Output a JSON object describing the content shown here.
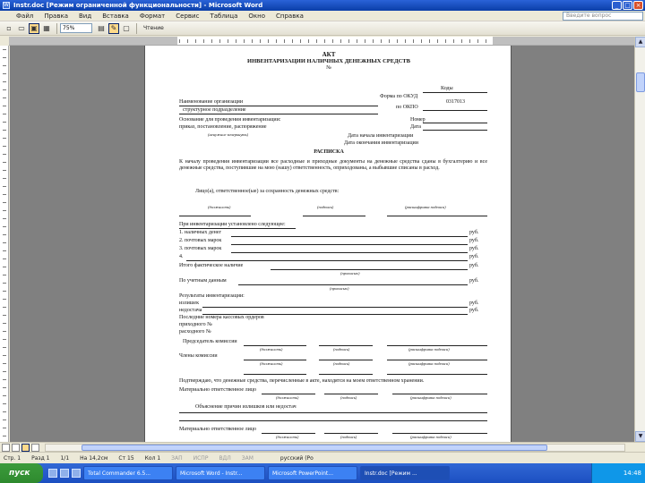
{
  "window": {
    "title": "Instr.doc [Режим ограниченной функциональности] - Microsoft Word",
    "buttons": [
      "_",
      "□",
      "×"
    ]
  },
  "menu": {
    "items": [
      "Файл",
      "Правка",
      "Вид",
      "Вставка",
      "Формат",
      "Сервис",
      "Таблица",
      "Окно",
      "Справка"
    ],
    "help_placeholder": "Введите вопрос"
  },
  "toolbar": {
    "zoom": "75%",
    "mode_label": "Чтение"
  },
  "document": {
    "title": "АКТ",
    "subtitle": "ИНВЕНТАРИЗАЦИИ НАЛИЧНЫХ ДЕНЕЖНЫХ СРЕДСТВ",
    "number_mark": "№",
    "codes_label": "Коды",
    "form_okud": "Форма по ОКУД",
    "form_okud_value": "0317013",
    "okpo": "по ОКПО",
    "org_name": "Наименование организации",
    "dept": "структурное подразделение",
    "basis": "Основание для проведения инвентаризации:",
    "basis_line2": "приказ, постановление, распоряжение",
    "basis_note": "(ненужное зачеркнуть)",
    "number_label": "Номер",
    "date_label": "Дата",
    "date_start": "Дата начала инвентаризации",
    "date_end": "Дата окончания инвентаризации",
    "receipt_title": "РАСПИСКА",
    "receipt_text": "К началу проведения инвентаризации все расходные и приходные документы на денежные средства сданы в бухгалтерию и все денежные средства, поступившие на мою (нашу) ответственность, оприходованы, а выбывшие списаны в расход.",
    "receipt_person": "Лицо(а), ответственное(ые) за сохранность денежных средств:",
    "sig_labels": [
      "(должность)",
      "(подпись)",
      "(расшифровка подписи)"
    ],
    "found_title": "При инвентаризации установлено следующее:",
    "rows": [
      {
        "label": "1. наличных денег",
        "unit": "руб."
      },
      {
        "label": "2. почтовых марок",
        "unit": "руб."
      },
      {
        "label": "3. почтовых марок",
        "unit": "руб."
      },
      {
        "label": "4.",
        "unit": "руб."
      }
    ],
    "total_label": "Итого фактическое наличие",
    "total_unit": "руб.",
    "sum_words": "(прописью)",
    "account_label": "По учетным данным",
    "account_unit": "руб.",
    "result_label": "Результаты инвентаризации:",
    "surplus": "излишек",
    "shortage": "недостача",
    "result_unit": "руб.",
    "last_numbers": "Последние номера кассовых ордеров",
    "order_in": "приходного №",
    "order_out": "расходного №",
    "commission_chair": "Председатель комиссии",
    "commission_members": "Члены комиссии",
    "declaration": "Подтверждаю, что денежные средства, перечисленные в акте, находятся на моем ответственном хранении.",
    "responsible": "Материально ответственное лицо",
    "explanation": "Объяснение причин излишков или недостач",
    "responsible2": "Материально ответственное лицо"
  },
  "status": {
    "page": "Стр. 1",
    "section": "Разд 1",
    "pages": "1/1",
    "position": "На 14,2см",
    "line": "Ст 15",
    "col": "Кол 1",
    "modes": [
      "ЗАП",
      "ИСПР",
      "ВДЛ",
      "ЗАМ"
    ],
    "language": "русский (Ро"
  },
  "taskbar": {
    "start": "пуск",
    "tasks": [
      "Total Commander 6.5...",
      "Microsoft Word - Instr...",
      "Microsoft PowerPoint...",
      "Instr.doc [Режим ..."
    ],
    "clock": "14:48"
  }
}
